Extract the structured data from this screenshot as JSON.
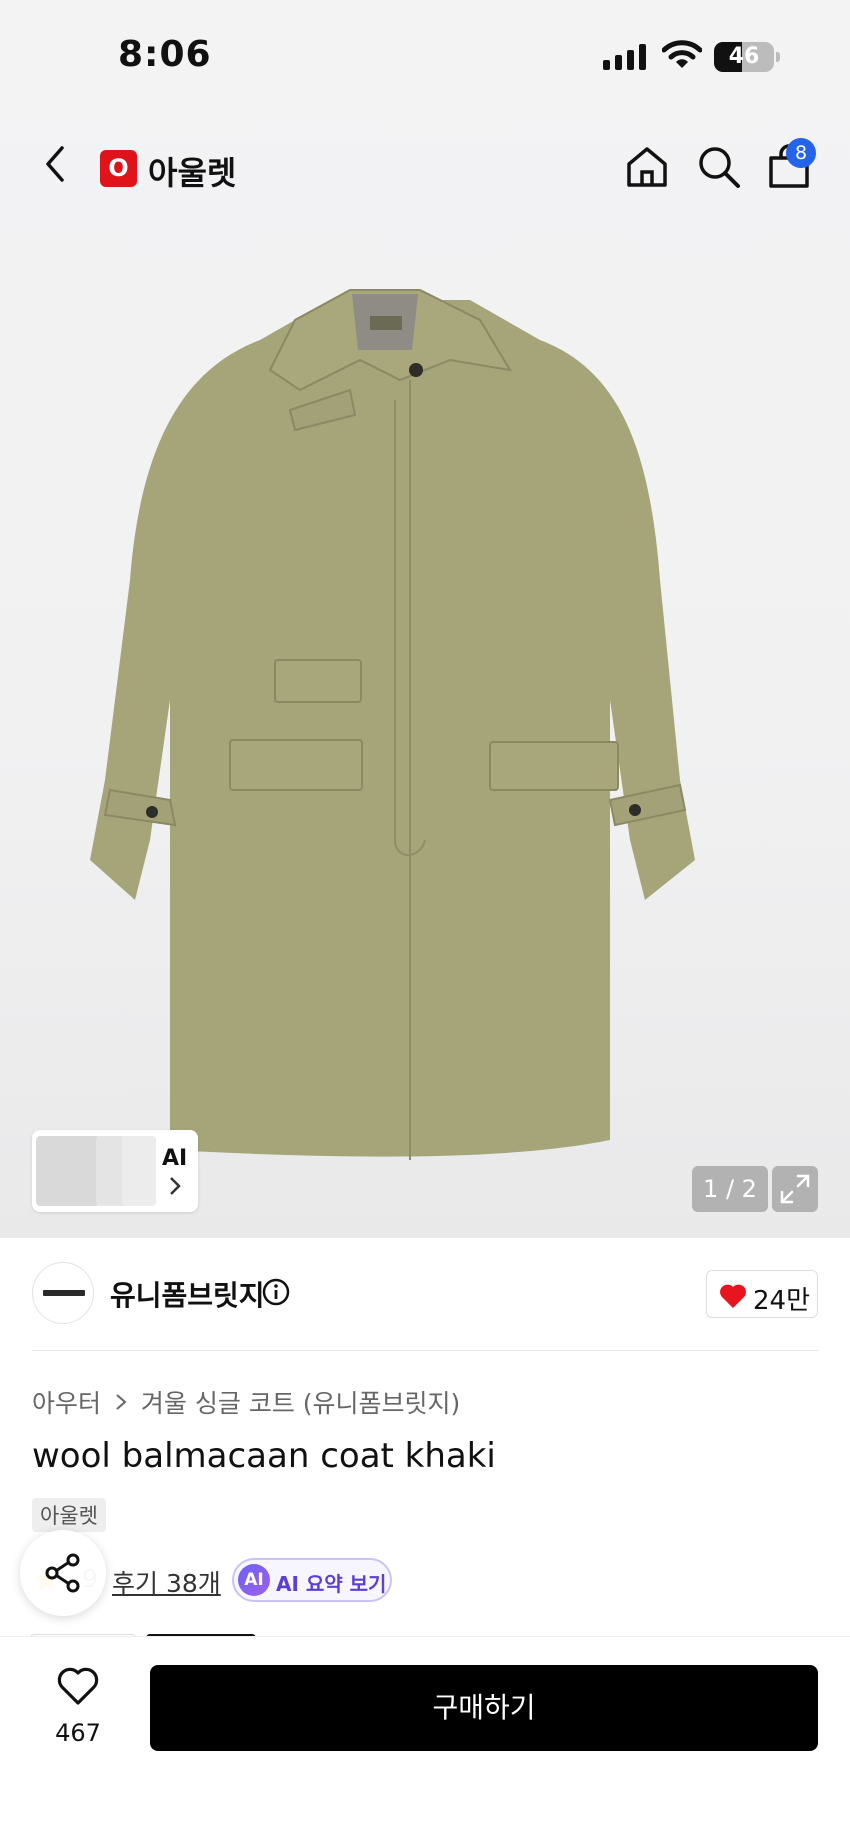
{
  "status_bar": {
    "time": "8:06",
    "battery_percent": 46
  },
  "header": {
    "logo_letter": "O",
    "title": "아울렛",
    "cart_count": "8"
  },
  "gallery": {
    "ai_label": "AI",
    "pager": "1 / 2",
    "product_color": "#a6a57a"
  },
  "brand": {
    "name": "유니폼브릿지",
    "likes": "24만"
  },
  "product": {
    "breadcrumb": [
      "아우터",
      "겨울 싱글 코트 (유니폼브릿지)"
    ],
    "title": "wool balmacaan coat khaki",
    "tag": "아울렛",
    "rating_partial": ".9",
    "reviews": "후기 38개",
    "ai_summary_badge": "AI",
    "ai_summary_label": "AI 요약 보기"
  },
  "bottom": {
    "wish_count": "467",
    "buy_label": "구매하기"
  },
  "colors": {
    "accent_red": "#e0121a",
    "badge_blue": "#2563eb",
    "ai_purple": "#5b3fd6",
    "heart_red": "#e8141e"
  }
}
